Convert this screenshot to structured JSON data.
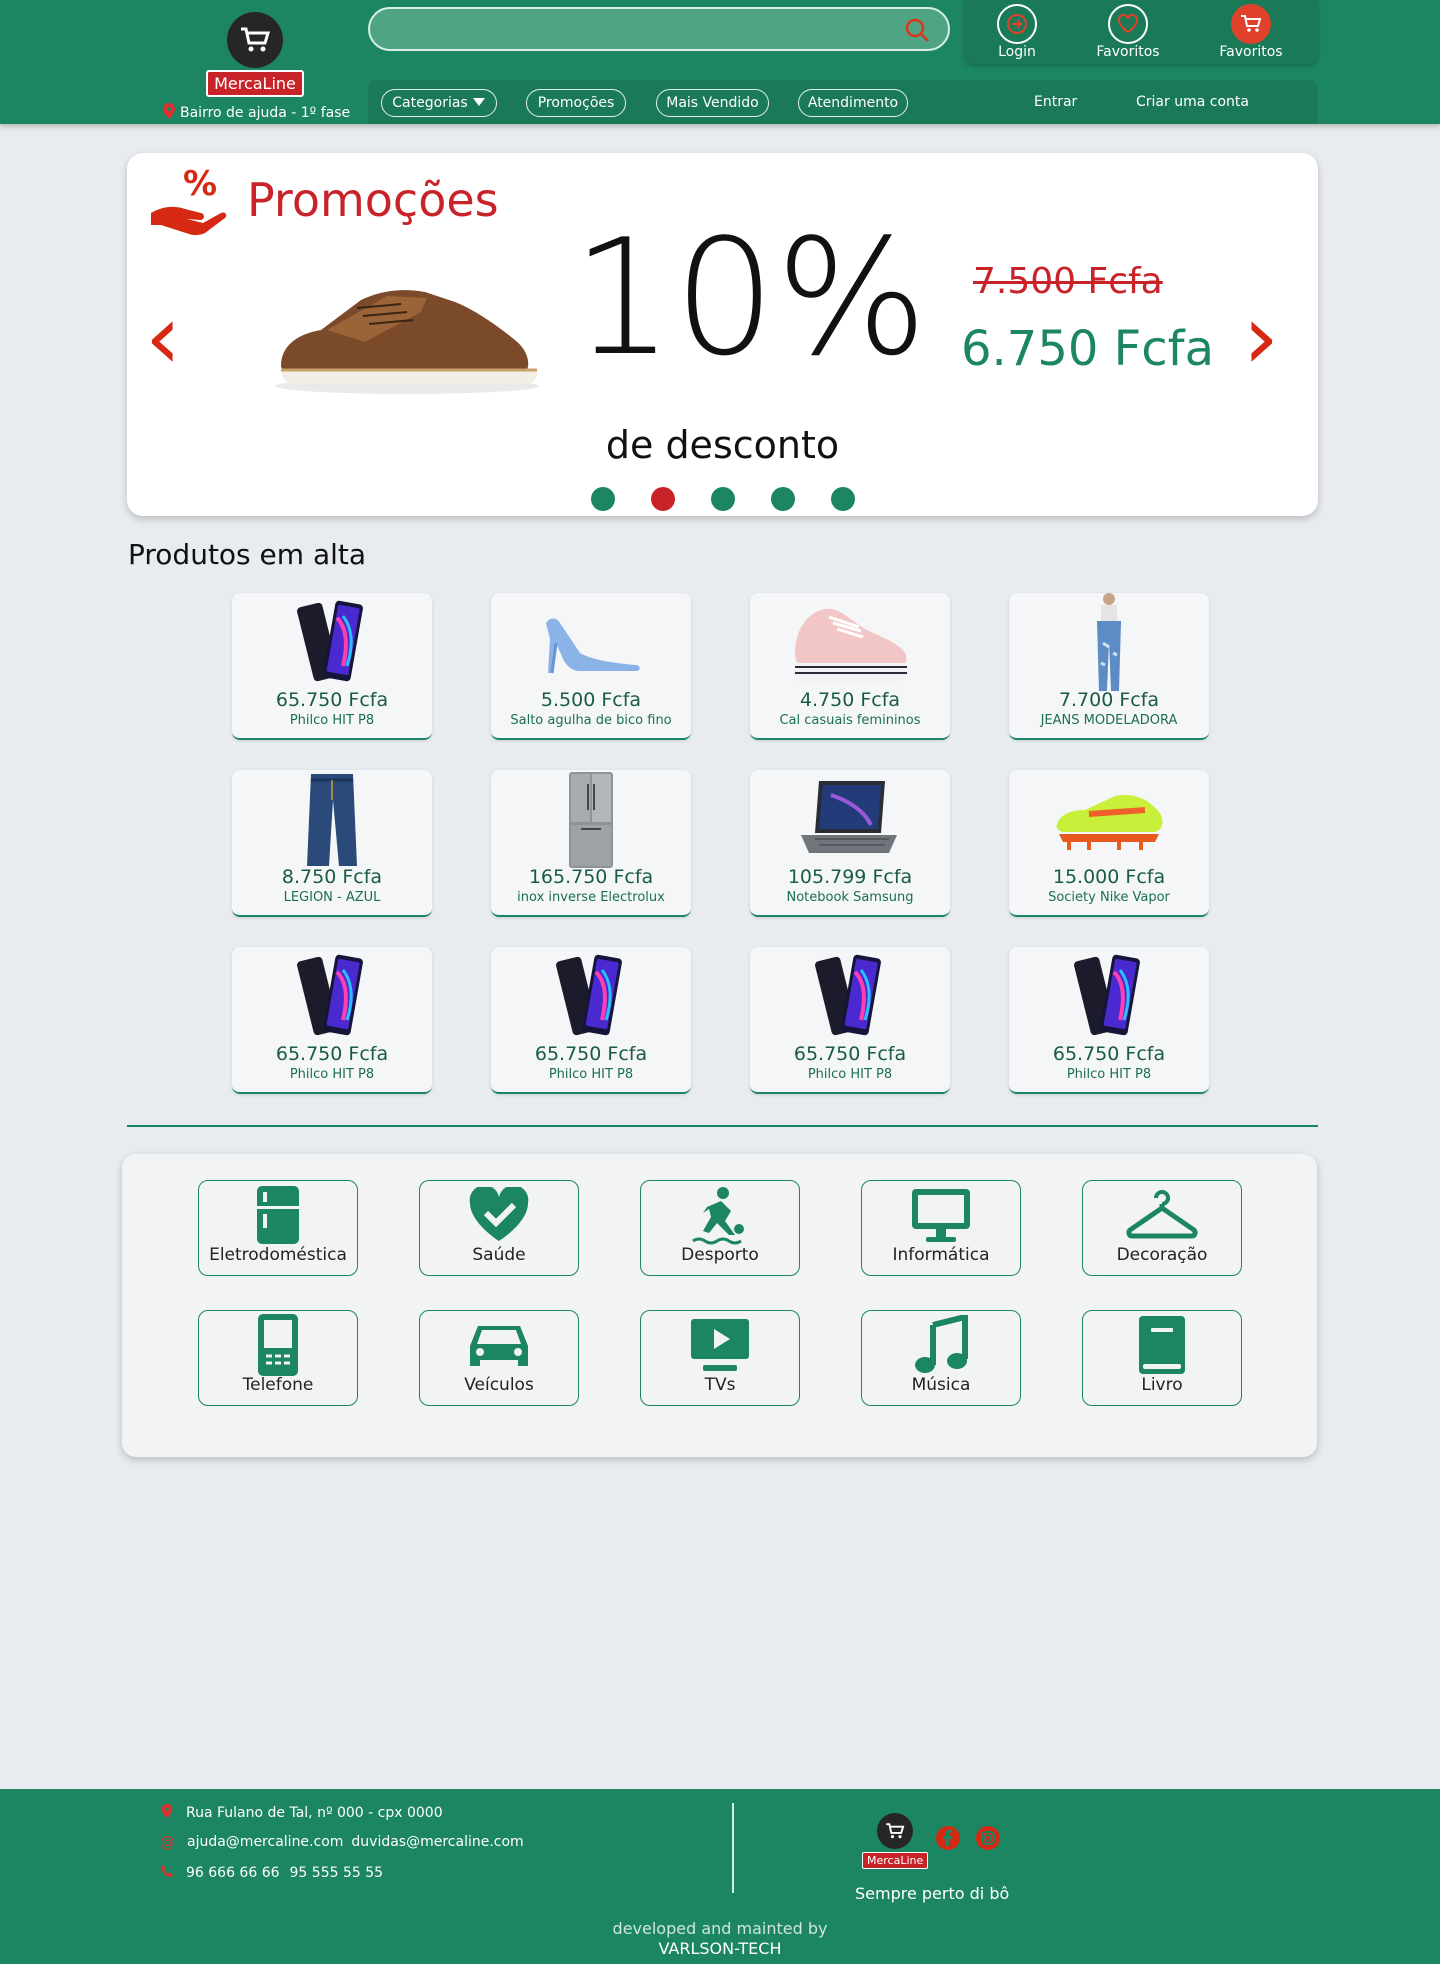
{
  "brand": {
    "name": "MercaLine",
    "location": "Bairro de ajuda - 1º fase"
  },
  "search": {
    "placeholder": ""
  },
  "user_menu": [
    {
      "label": "Login",
      "icon": "login-icon"
    },
    {
      "label": "Favoritos",
      "icon": "heart-icon"
    },
    {
      "label": "Favoritos",
      "icon": "cart-icon"
    }
  ],
  "nav": {
    "categories": "Categorias",
    "promotions": "Promoções",
    "best_sellers": "Mais Vendido",
    "support": "Atendimento",
    "login": "Entrar",
    "signup": "Criar uma conta"
  },
  "promo": {
    "title": "Promoções",
    "percent": "10%",
    "old_price": "7.500 Fcfa",
    "new_price": "6.750 Fcfa",
    "discount_text": "de desconto",
    "slides": 5,
    "active_slide": 2
  },
  "products_title": "Produtos em alta",
  "products": [
    {
      "price": "65.750 Fcfa",
      "name": "Philco HIT P8",
      "img": "phone"
    },
    {
      "price": "5.500 Fcfa",
      "name": "Salto agulha de bico fino",
      "img": "heel"
    },
    {
      "price": "4.750 Fcfa",
      "name": "Cal casuais femininos",
      "img": "sneaker"
    },
    {
      "price": "7.700 Fcfa",
      "name": "JEANS MODELADORA",
      "img": "jeans-woman"
    },
    {
      "price": "8.750 Fcfa",
      "name": "LEGION - AZUL",
      "img": "jeans"
    },
    {
      "price": "165.750 Fcfa",
      "name": "inox inverse Electrolux",
      "img": "fridge"
    },
    {
      "price": "105.799 Fcfa",
      "name": "Notebook Samsung",
      "img": "laptop"
    },
    {
      "price": "15.000 Fcfa",
      "name": "Society Nike Vapor",
      "img": "football-boot"
    },
    {
      "price": "65.750 Fcfa",
      "name": "Philco HIT P8",
      "img": "phone"
    },
    {
      "price": "65.750 Fcfa",
      "name": "Philco HIT P8",
      "img": "phone"
    },
    {
      "price": "65.750 Fcfa",
      "name": "Philco HIT P8",
      "img": "phone"
    },
    {
      "price": "65.750 Fcfa",
      "name": "Philco HIT P8",
      "img": "phone"
    }
  ],
  "categories": [
    {
      "label": "Eletrodoméstica",
      "icon": "fridge-icon"
    },
    {
      "label": "Saúde",
      "icon": "heart-check-icon"
    },
    {
      "label": "Desporto",
      "icon": "football-player-icon"
    },
    {
      "label": "Informática",
      "icon": "monitor-icon"
    },
    {
      "label": "Decoração",
      "icon": "hanger-icon"
    },
    {
      "label": "Telefone",
      "icon": "phone-icon"
    },
    {
      "label": "Veículos",
      "icon": "car-icon"
    },
    {
      "label": "TVs",
      "icon": "tv-play-icon"
    },
    {
      "label": "Música",
      "icon": "music-icon"
    },
    {
      "label": "Livro",
      "icon": "book-icon"
    }
  ],
  "footer": {
    "address": "Rua Fulano de Tal, nº 000 - cpx 0000",
    "email1": "ajuda@mercaline.com",
    "email2": "duvidas@mercaline.com",
    "phone1": "96 666 66 66",
    "phone2": "95 555 55 55",
    "slogan": "Sempre perto di bô",
    "dev_line1": "developed and mainted by",
    "dev_line2": "VARLSON-TECH"
  },
  "colors": {
    "primary": "#1c8561",
    "accent": "#c9232a",
    "background": "#e8ebef"
  }
}
